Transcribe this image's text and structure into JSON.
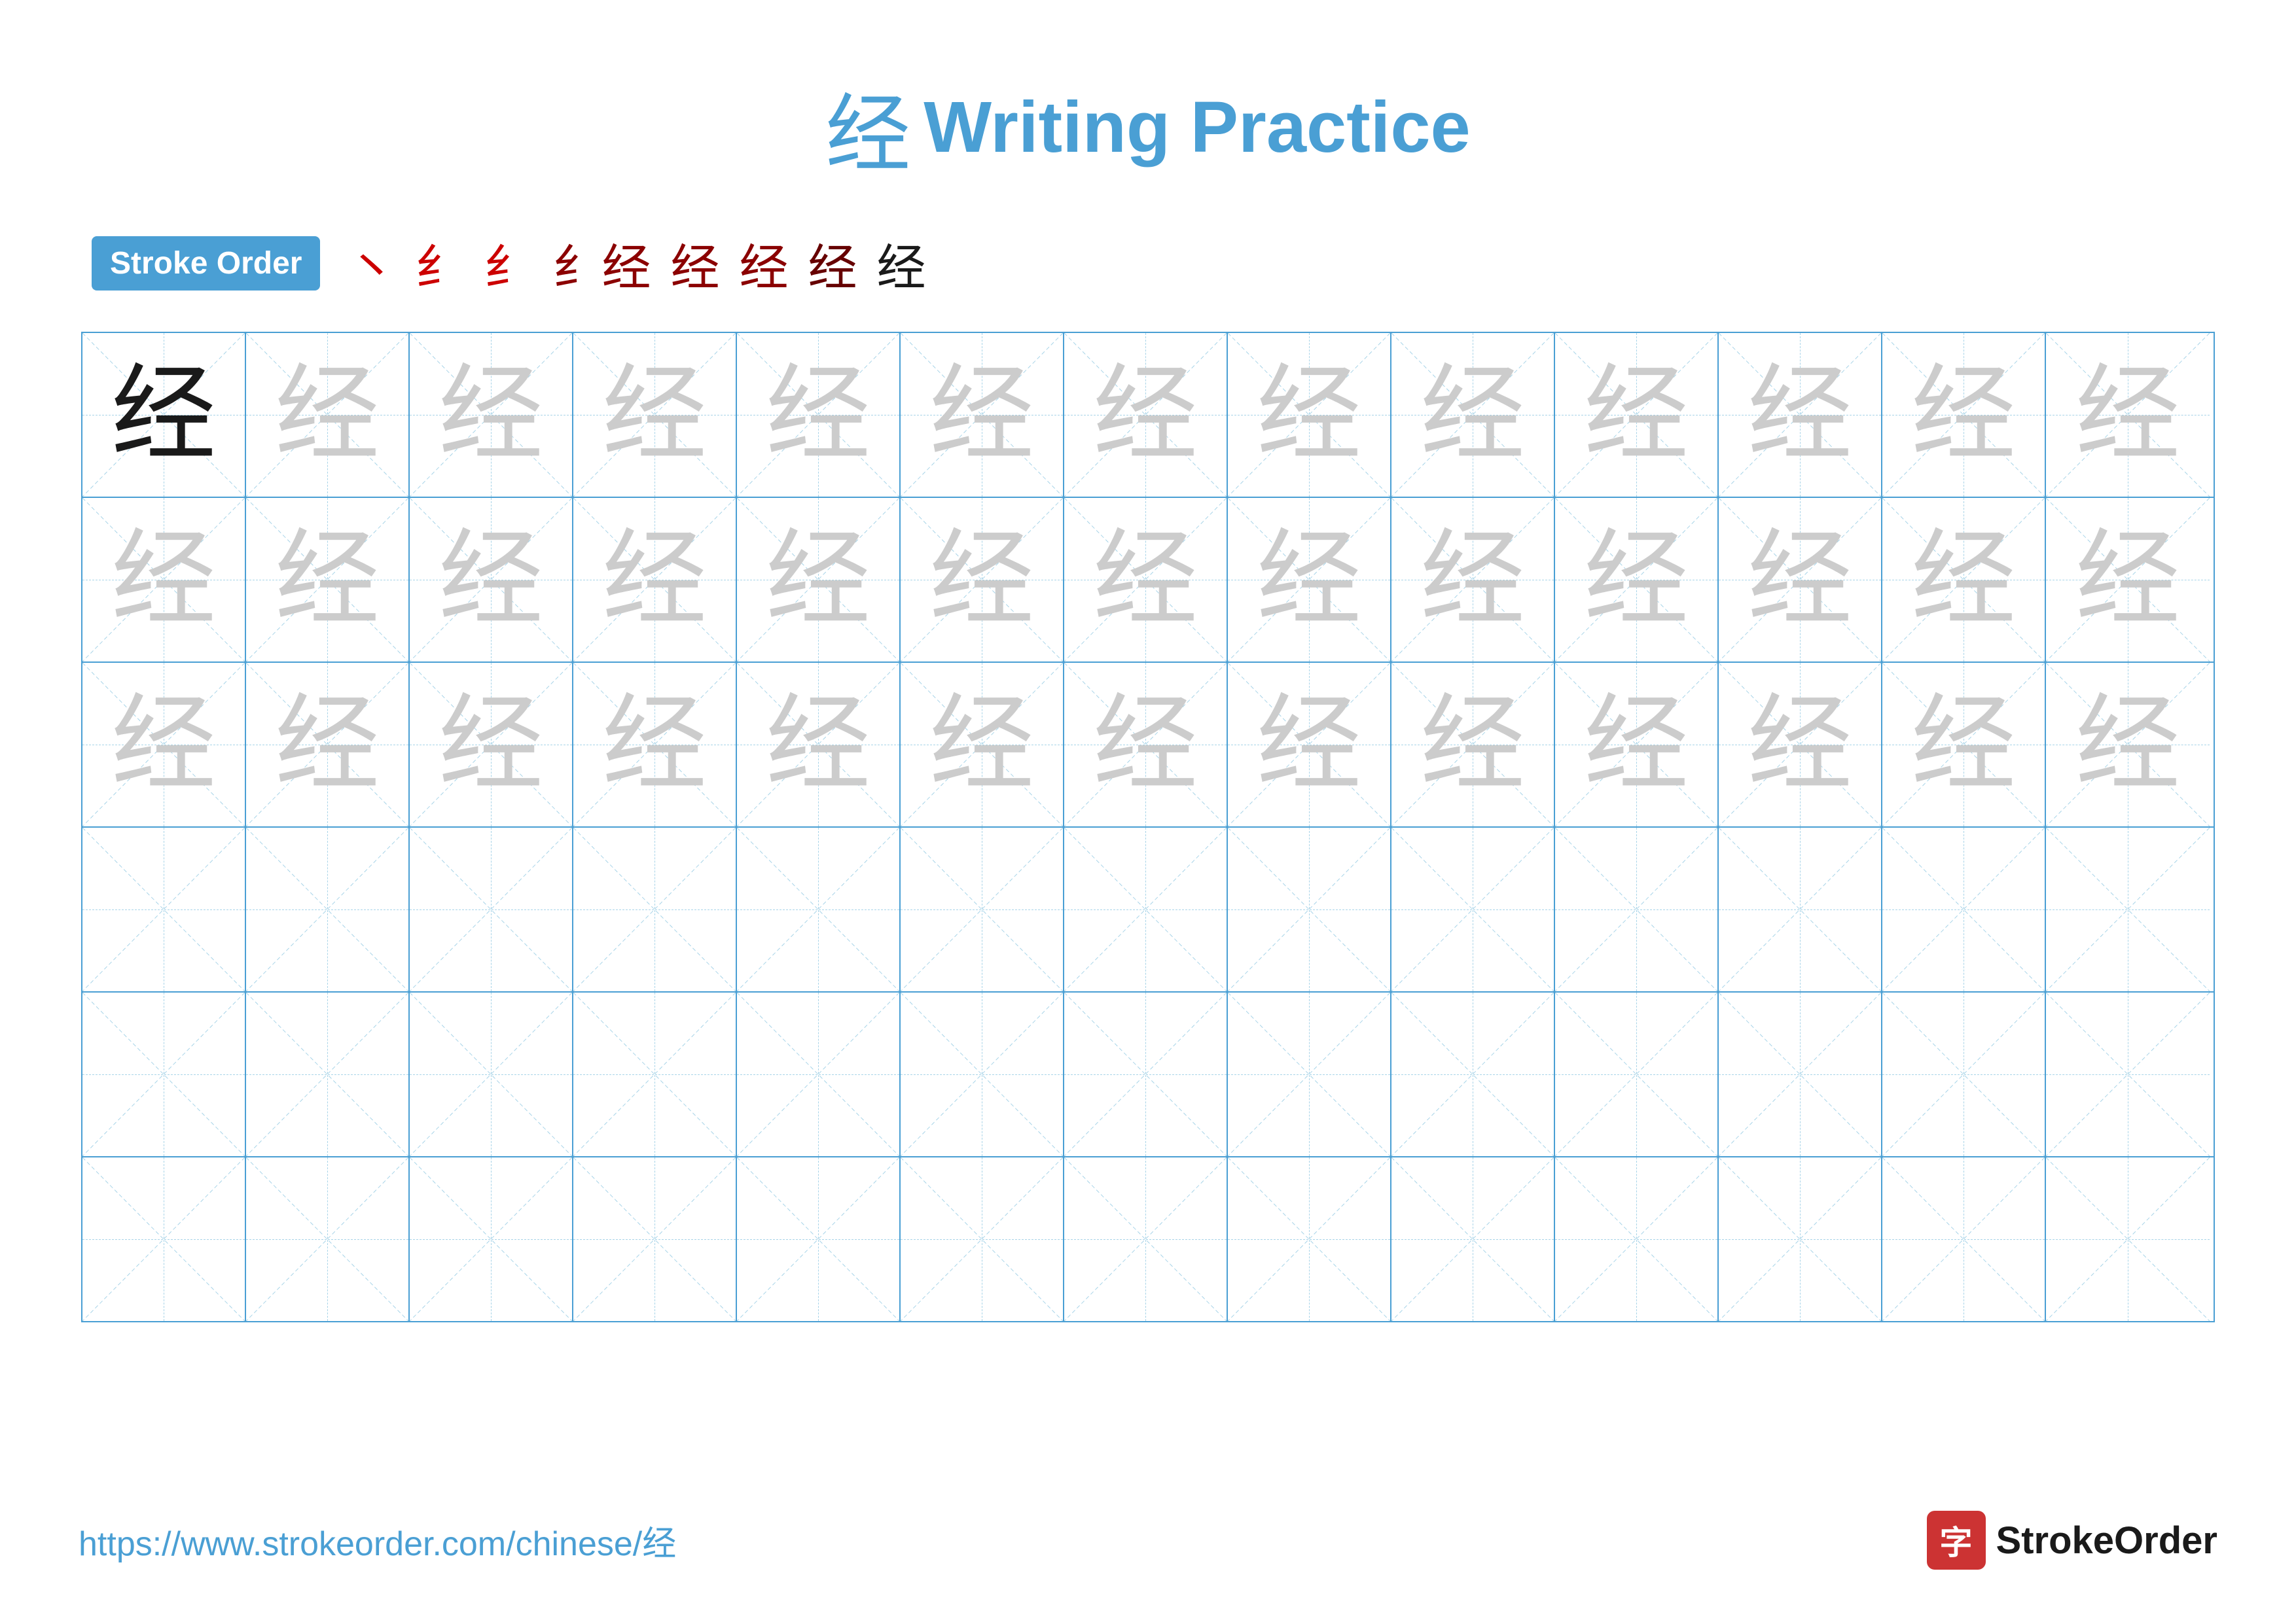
{
  "title": {
    "char": "经",
    "text": "Writing Practice"
  },
  "stroke_order": {
    "badge_label": "Stroke Order",
    "strokes": [
      "㇀",
      "纟",
      "纟",
      "纟经",
      "纟经",
      "纟经",
      "纟经",
      "经"
    ]
  },
  "grid": {
    "rows": 6,
    "cols": 13,
    "char": "经",
    "row_types": [
      "solid_then_light",
      "light",
      "light",
      "empty",
      "empty",
      "empty"
    ]
  },
  "footer": {
    "url": "https://www.strokeorder.com/chinese/经",
    "logo_char": "字",
    "logo_text": "StrokeOrder"
  }
}
